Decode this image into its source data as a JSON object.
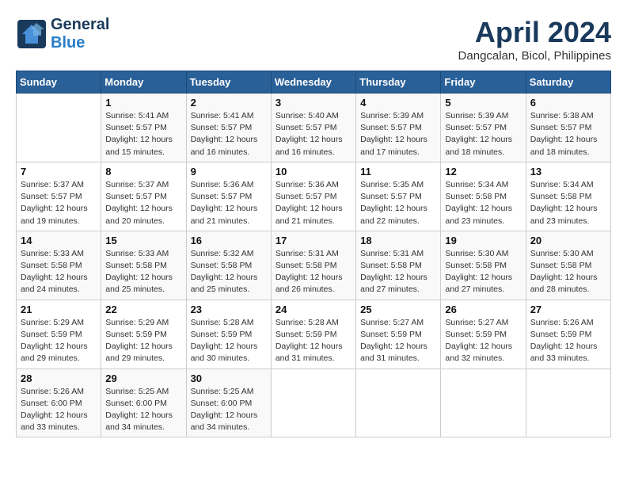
{
  "header": {
    "logo_general": "General",
    "logo_blue": "Blue",
    "month_title": "April 2024",
    "location": "Dangcalan, Bicol, Philippines"
  },
  "days_of_week": [
    "Sunday",
    "Monday",
    "Tuesday",
    "Wednesday",
    "Thursday",
    "Friday",
    "Saturday"
  ],
  "weeks": [
    [
      {
        "num": "",
        "info": ""
      },
      {
        "num": "1",
        "info": "Sunrise: 5:41 AM\nSunset: 5:57 PM\nDaylight: 12 hours\nand 15 minutes."
      },
      {
        "num": "2",
        "info": "Sunrise: 5:41 AM\nSunset: 5:57 PM\nDaylight: 12 hours\nand 16 minutes."
      },
      {
        "num": "3",
        "info": "Sunrise: 5:40 AM\nSunset: 5:57 PM\nDaylight: 12 hours\nand 16 minutes."
      },
      {
        "num": "4",
        "info": "Sunrise: 5:39 AM\nSunset: 5:57 PM\nDaylight: 12 hours\nand 17 minutes."
      },
      {
        "num": "5",
        "info": "Sunrise: 5:39 AM\nSunset: 5:57 PM\nDaylight: 12 hours\nand 18 minutes."
      },
      {
        "num": "6",
        "info": "Sunrise: 5:38 AM\nSunset: 5:57 PM\nDaylight: 12 hours\nand 18 minutes."
      }
    ],
    [
      {
        "num": "7",
        "info": "Sunrise: 5:37 AM\nSunset: 5:57 PM\nDaylight: 12 hours\nand 19 minutes."
      },
      {
        "num": "8",
        "info": "Sunrise: 5:37 AM\nSunset: 5:57 PM\nDaylight: 12 hours\nand 20 minutes."
      },
      {
        "num": "9",
        "info": "Sunrise: 5:36 AM\nSunset: 5:57 PM\nDaylight: 12 hours\nand 21 minutes."
      },
      {
        "num": "10",
        "info": "Sunrise: 5:36 AM\nSunset: 5:57 PM\nDaylight: 12 hours\nand 21 minutes."
      },
      {
        "num": "11",
        "info": "Sunrise: 5:35 AM\nSunset: 5:57 PM\nDaylight: 12 hours\nand 22 minutes."
      },
      {
        "num": "12",
        "info": "Sunrise: 5:34 AM\nSunset: 5:58 PM\nDaylight: 12 hours\nand 23 minutes."
      },
      {
        "num": "13",
        "info": "Sunrise: 5:34 AM\nSunset: 5:58 PM\nDaylight: 12 hours\nand 23 minutes."
      }
    ],
    [
      {
        "num": "14",
        "info": "Sunrise: 5:33 AM\nSunset: 5:58 PM\nDaylight: 12 hours\nand 24 minutes."
      },
      {
        "num": "15",
        "info": "Sunrise: 5:33 AM\nSunset: 5:58 PM\nDaylight: 12 hours\nand 25 minutes."
      },
      {
        "num": "16",
        "info": "Sunrise: 5:32 AM\nSunset: 5:58 PM\nDaylight: 12 hours\nand 25 minutes."
      },
      {
        "num": "17",
        "info": "Sunrise: 5:31 AM\nSunset: 5:58 PM\nDaylight: 12 hours\nand 26 minutes."
      },
      {
        "num": "18",
        "info": "Sunrise: 5:31 AM\nSunset: 5:58 PM\nDaylight: 12 hours\nand 27 minutes."
      },
      {
        "num": "19",
        "info": "Sunrise: 5:30 AM\nSunset: 5:58 PM\nDaylight: 12 hours\nand 27 minutes."
      },
      {
        "num": "20",
        "info": "Sunrise: 5:30 AM\nSunset: 5:58 PM\nDaylight: 12 hours\nand 28 minutes."
      }
    ],
    [
      {
        "num": "21",
        "info": "Sunrise: 5:29 AM\nSunset: 5:59 PM\nDaylight: 12 hours\nand 29 minutes."
      },
      {
        "num": "22",
        "info": "Sunrise: 5:29 AM\nSunset: 5:59 PM\nDaylight: 12 hours\nand 29 minutes."
      },
      {
        "num": "23",
        "info": "Sunrise: 5:28 AM\nSunset: 5:59 PM\nDaylight: 12 hours\nand 30 minutes."
      },
      {
        "num": "24",
        "info": "Sunrise: 5:28 AM\nSunset: 5:59 PM\nDaylight: 12 hours\nand 31 minutes."
      },
      {
        "num": "25",
        "info": "Sunrise: 5:27 AM\nSunset: 5:59 PM\nDaylight: 12 hours\nand 31 minutes."
      },
      {
        "num": "26",
        "info": "Sunrise: 5:27 AM\nSunset: 5:59 PM\nDaylight: 12 hours\nand 32 minutes."
      },
      {
        "num": "27",
        "info": "Sunrise: 5:26 AM\nSunset: 5:59 PM\nDaylight: 12 hours\nand 33 minutes."
      }
    ],
    [
      {
        "num": "28",
        "info": "Sunrise: 5:26 AM\nSunset: 6:00 PM\nDaylight: 12 hours\nand 33 minutes."
      },
      {
        "num": "29",
        "info": "Sunrise: 5:25 AM\nSunset: 6:00 PM\nDaylight: 12 hours\nand 34 minutes."
      },
      {
        "num": "30",
        "info": "Sunrise: 5:25 AM\nSunset: 6:00 PM\nDaylight: 12 hours\nand 34 minutes."
      },
      {
        "num": "",
        "info": ""
      },
      {
        "num": "",
        "info": ""
      },
      {
        "num": "",
        "info": ""
      },
      {
        "num": "",
        "info": ""
      }
    ]
  ]
}
